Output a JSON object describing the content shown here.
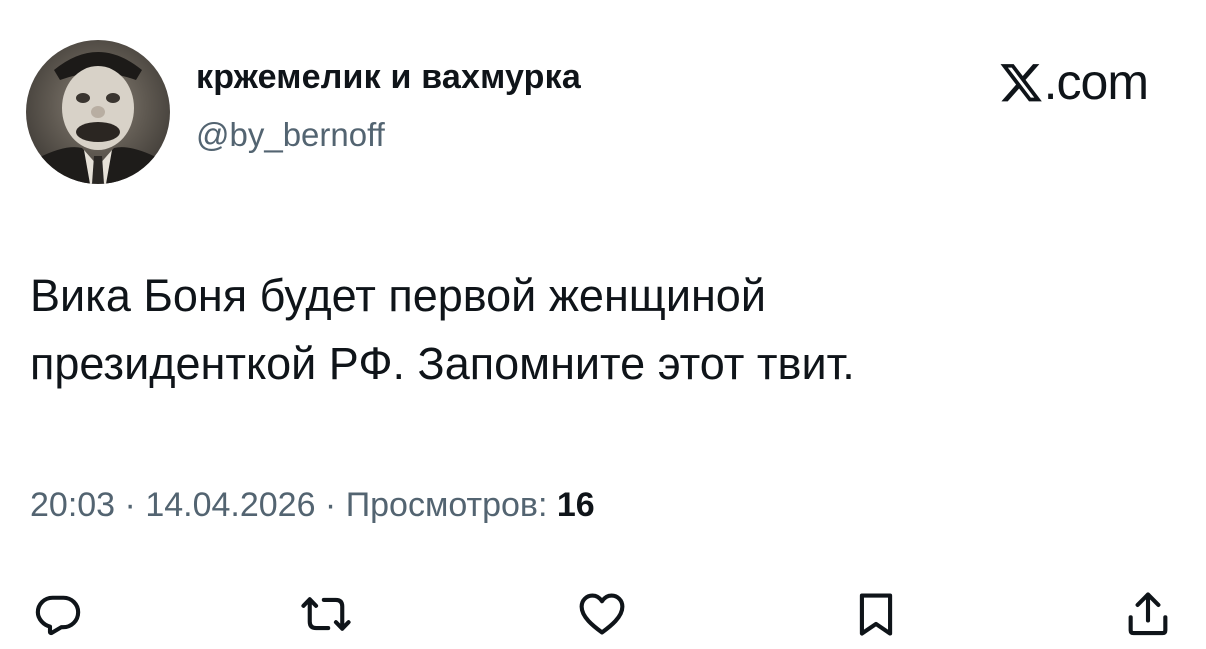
{
  "tweet": {
    "author": {
      "display_name": "кржемелик и вахмурка",
      "handle": "@by_bernoff"
    },
    "brand": {
      "logo_icon": "x-logo-icon",
      "suffix": ".com"
    },
    "text_lines": [
      "Вика Боня будет первой женщиной",
      "президенткой РФ. Запомните этот твит."
    ],
    "meta": {
      "time": "20:03",
      "separator": " · ",
      "date": "14.04.2026",
      "views_label": "Просмотров:",
      "views_count": "16"
    },
    "actions": [
      {
        "icon": "reply-icon"
      },
      {
        "icon": "retweet-icon"
      },
      {
        "icon": "like-icon"
      },
      {
        "icon": "bookmark-icon"
      },
      {
        "icon": "share-icon"
      }
    ]
  },
  "colors": {
    "text_primary": "#0f1419",
    "text_secondary": "#536471",
    "background": "#ffffff"
  }
}
